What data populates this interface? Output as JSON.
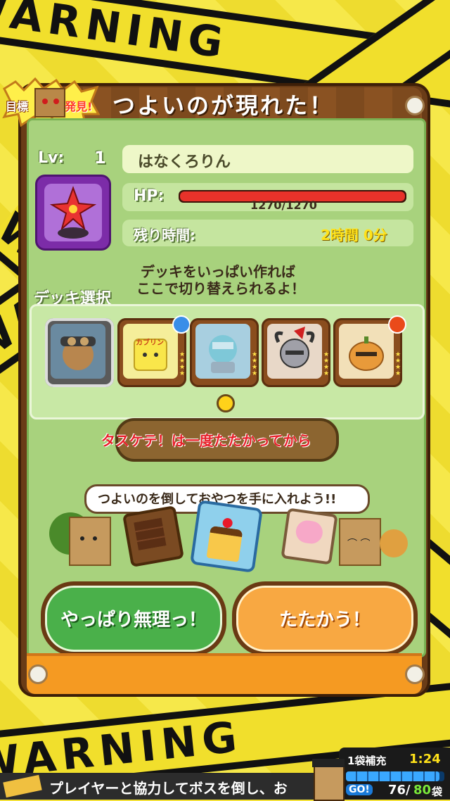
{
  "background": {
    "tape_text": "WARNING"
  },
  "badge": {
    "line1": "目標",
    "line2": "発見!"
  },
  "title": "つよいのが現れた！",
  "boss": {
    "level_label": "Lv:",
    "level_value": "1",
    "name": "はなくろりん",
    "hp_label": "HP:",
    "hp_text": "1270/1270",
    "hp_fraction": 1.0,
    "time_label": "残り時間:",
    "time_value": "2時間 0分"
  },
  "deck": {
    "hint_line1": "デッキをいっぱい作れば",
    "hint_line2": "ここで切り替えられるよ！",
    "section_label": "デッキ選択",
    "cards": [
      {
        "name": "goggle-girl",
        "label": ""
      },
      {
        "name": "kaburin",
        "label": "カブリン"
      },
      {
        "name": "fish-knight",
        "label": ""
      },
      {
        "name": "horned-knight",
        "label": ""
      },
      {
        "name": "pumpkin",
        "label": ""
      }
    ]
  },
  "help_notice": "タスケテ！は一度たたかってから",
  "reward_banner": "つよいのを倒しておやつを手に入れよう!!",
  "buttons": {
    "retreat": "やっぱり無理っ！",
    "fight": "たたかう！"
  },
  "ticker": "プレイヤーと協力してボスを倒し、お",
  "hud": {
    "refill_label": "1袋補充",
    "refill_time": "1:24",
    "go_label": "GO!",
    "bags_current": "76",
    "bags_max": "80",
    "bags_unit": "袋"
  },
  "colors": {
    "hp_bar": "#e8322a",
    "time_value": "#ffe21a",
    "help_notice": "#e8202a"
  }
}
